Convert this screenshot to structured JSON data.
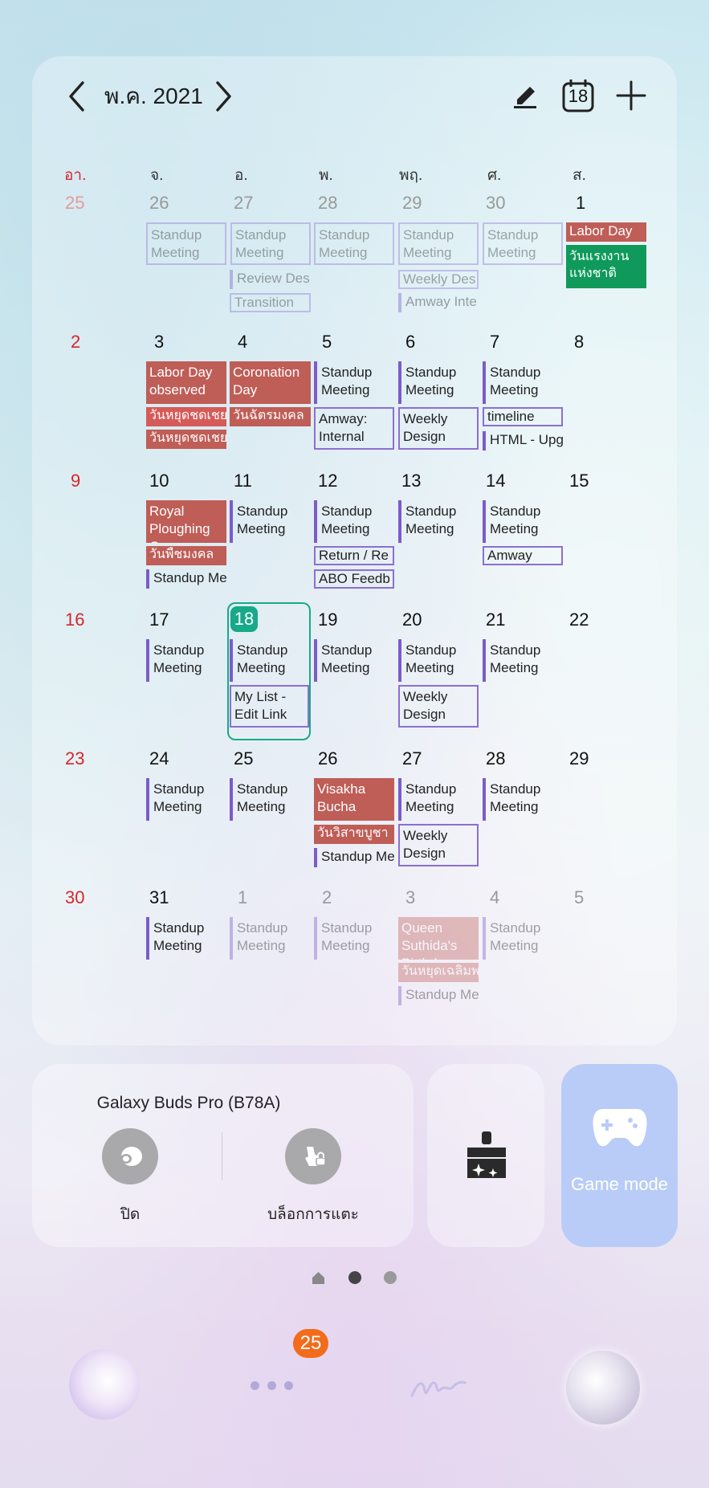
{
  "calendar": {
    "month_title": "พ.ค. 2021",
    "weekdays": [
      "อา.",
      "จ.",
      "อ.",
      "พ.",
      "พฤ.",
      "ศ.",
      "ส."
    ],
    "header_icons": [
      "chevron-left-icon",
      "chevron-right-icon",
      "edit-icon",
      "today-calendar-icon",
      "add-icon"
    ],
    "today_icon_number": "18",
    "today": "18",
    "weeks": [
      [
        "25",
        "26",
        "27",
        "28",
        "29",
        "30",
        "1"
      ],
      [
        "2",
        "3",
        "4",
        "5",
        "6",
        "7",
        "8"
      ],
      [
        "9",
        "10",
        "11",
        "12",
        "13",
        "14",
        "15"
      ],
      [
        "16",
        "17",
        "18",
        "19",
        "20",
        "21",
        "22"
      ],
      [
        "23",
        "24",
        "25",
        "26",
        "27",
        "28",
        "29"
      ],
      [
        "30",
        "31",
        "1",
        "2",
        "3",
        "4",
        "5"
      ]
    ],
    "events": {
      "standup": "Standup Meeting",
      "review_des": "Review Des",
      "transition": "Transition",
      "weekly_des": "Weekly Des",
      "amway_inte": "Amway Inte",
      "labor_day": "Labor Day",
      "labor_day_th": "วันแรงงานแห่งชาติ",
      "labor_day_observed": "Labor Day observed",
      "holiday_sub_1": "วันหยุดชดเชย",
      "holiday_sub_2": "วันหยุดชดเชย",
      "coronation_day": "Coronation Day",
      "coronation_th": "วันฉัตรมงคล",
      "amway_internal": "Amway: Internal Meeting",
      "weekly_design_review": "Weekly Design Review",
      "timeline": "timeline",
      "html_upg": "HTML - Upg",
      "royal_ploughing": "Royal Ploughing Ceremony",
      "royal_ploughing_th": "วันพืชมงคล",
      "standup_short": "Standup Me",
      "return": "Return / Re",
      "abo_feedback": "ABO Feedb",
      "amway": "Amway",
      "my_list": "My List - Edit Link",
      "visakha": "Visakha Bucha",
      "visakha_th": "วันวิสาขบูชา",
      "queen_birthday": "Queen Suthida's Birthday",
      "queen_birthday_th": "วันหยุดเฉลิมพ"
    }
  },
  "buds_widget": {
    "device_name": "Galaxy Buds Pro (B78A)",
    "left_label": "ปิด",
    "right_label": "บล็อกการแตะ"
  },
  "game_widget": {
    "label": "Game mode"
  },
  "page_indicator": {
    "pages": 3,
    "active": 1
  },
  "dock": {
    "badge": "25"
  },
  "colors": {
    "holiday_red": "#bf5d57",
    "holiday_green": "#0f9a5b",
    "event_purple": "#7b5cc9",
    "today_teal": "#18a88a",
    "sunday_red": "#d7262b",
    "badge_orange": "#f36c1c",
    "game_blue": "#b9ccf7"
  }
}
